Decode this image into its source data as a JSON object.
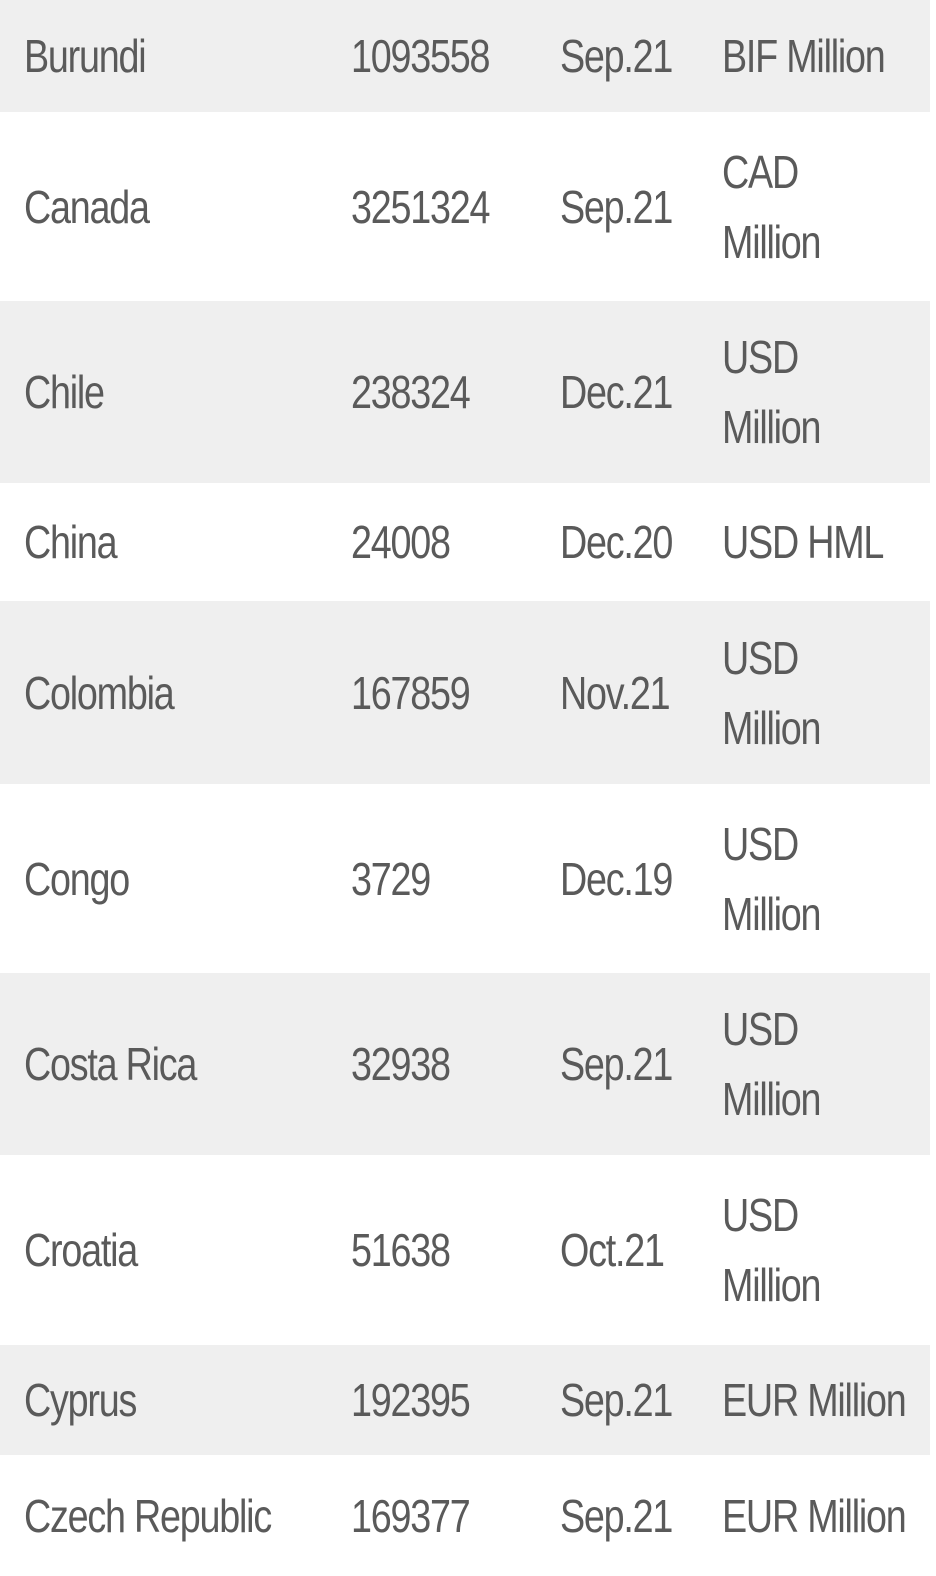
{
  "rows": [
    {
      "country": "Burundi",
      "value": "1093558",
      "date": "Sep.21",
      "unit": "BIF Million"
    },
    {
      "country": "Canada",
      "value": "3251324",
      "date": "Sep.21",
      "unit": "CAD Million"
    },
    {
      "country": "Chile",
      "value": "238324",
      "date": "Dec.21",
      "unit": "USD Million"
    },
    {
      "country": "China",
      "value": "24008",
      "date": "Dec.20",
      "unit": "USD HML"
    },
    {
      "country": "Colombia",
      "value": "167859",
      "date": "Nov.21",
      "unit": "USD Million"
    },
    {
      "country": "Congo",
      "value": "3729",
      "date": "Dec.19",
      "unit": "USD Million"
    },
    {
      "country": "Costa Rica",
      "value": "32938",
      "date": "Sep.21",
      "unit": "USD Million"
    },
    {
      "country": "Croatia",
      "value": "51638",
      "date": "Oct.21",
      "unit": "USD Million"
    },
    {
      "country": "Cyprus",
      "value": "192395",
      "date": "Sep.21",
      "unit": "EUR Million"
    },
    {
      "country": "Czech Republic",
      "value": "169377",
      "date": "Sep.21",
      "unit": "EUR Million"
    }
  ]
}
